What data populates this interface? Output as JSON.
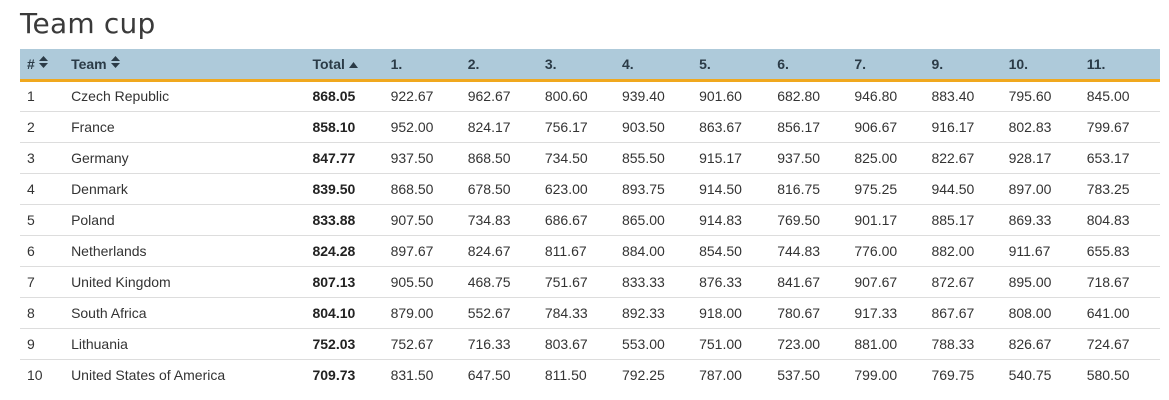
{
  "title": "Team cup",
  "columns": {
    "rank": "#",
    "team": "Team",
    "total": "Total",
    "rounds": [
      "1.",
      "2.",
      "3.",
      "4.",
      "5.",
      "6.",
      "7.",
      "9.",
      "10.",
      "11."
    ]
  },
  "sort_icons": {
    "rank": "both-arrows",
    "team": "both-arrows",
    "total": "ascending-arrow"
  },
  "rows": [
    {
      "rank": "1",
      "team": "Czech Republic",
      "total": "868.05",
      "scores": [
        "922.67",
        "962.67",
        "800.60",
        "939.40",
        "901.60",
        "682.80",
        "946.80",
        "883.40",
        "795.60",
        "845.00"
      ]
    },
    {
      "rank": "2",
      "team": "France",
      "total": "858.10",
      "scores": [
        "952.00",
        "824.17",
        "756.17",
        "903.50",
        "863.67",
        "856.17",
        "906.67",
        "916.17",
        "802.83",
        "799.67"
      ]
    },
    {
      "rank": "3",
      "team": "Germany",
      "total": "847.77",
      "scores": [
        "937.50",
        "868.50",
        "734.50",
        "855.50",
        "915.17",
        "937.50",
        "825.00",
        "822.67",
        "928.17",
        "653.17"
      ]
    },
    {
      "rank": "4",
      "team": "Denmark",
      "total": "839.50",
      "scores": [
        "868.50",
        "678.50",
        "623.00",
        "893.75",
        "914.50",
        "816.75",
        "975.25",
        "944.50",
        "897.00",
        "783.25"
      ]
    },
    {
      "rank": "5",
      "team": "Poland",
      "total": "833.88",
      "scores": [
        "907.50",
        "734.83",
        "686.67",
        "865.00",
        "914.83",
        "769.50",
        "901.17",
        "885.17",
        "869.33",
        "804.83"
      ]
    },
    {
      "rank": "6",
      "team": "Netherlands",
      "total": "824.28",
      "scores": [
        "897.67",
        "824.67",
        "811.67",
        "884.00",
        "854.50",
        "744.83",
        "776.00",
        "882.00",
        "911.67",
        "655.83"
      ]
    },
    {
      "rank": "7",
      "team": "United Kingdom",
      "total": "807.13",
      "scores": [
        "905.50",
        "468.75",
        "751.67",
        "833.33",
        "876.33",
        "841.67",
        "907.67",
        "872.67",
        "895.00",
        "718.67"
      ]
    },
    {
      "rank": "8",
      "team": "South Africa",
      "total": "804.10",
      "scores": [
        "879.00",
        "552.67",
        "784.33",
        "892.33",
        "918.00",
        "780.67",
        "917.33",
        "867.67",
        "808.00",
        "641.00"
      ]
    },
    {
      "rank": "9",
      "team": "Lithuania",
      "total": "752.03",
      "scores": [
        "752.67",
        "716.33",
        "803.67",
        "553.00",
        "751.00",
        "723.00",
        "881.00",
        "788.33",
        "826.67",
        "724.67"
      ]
    },
    {
      "rank": "10",
      "team": "United States of America",
      "total": "709.73",
      "scores": [
        "831.50",
        "647.50",
        "811.50",
        "792.25",
        "787.00",
        "537.50",
        "799.00",
        "769.75",
        "540.75",
        "580.50"
      ]
    }
  ],
  "colors": {
    "header_bg": "#aecada",
    "header_underline": "#f0a81e",
    "row_divider": "#dddddd"
  }
}
